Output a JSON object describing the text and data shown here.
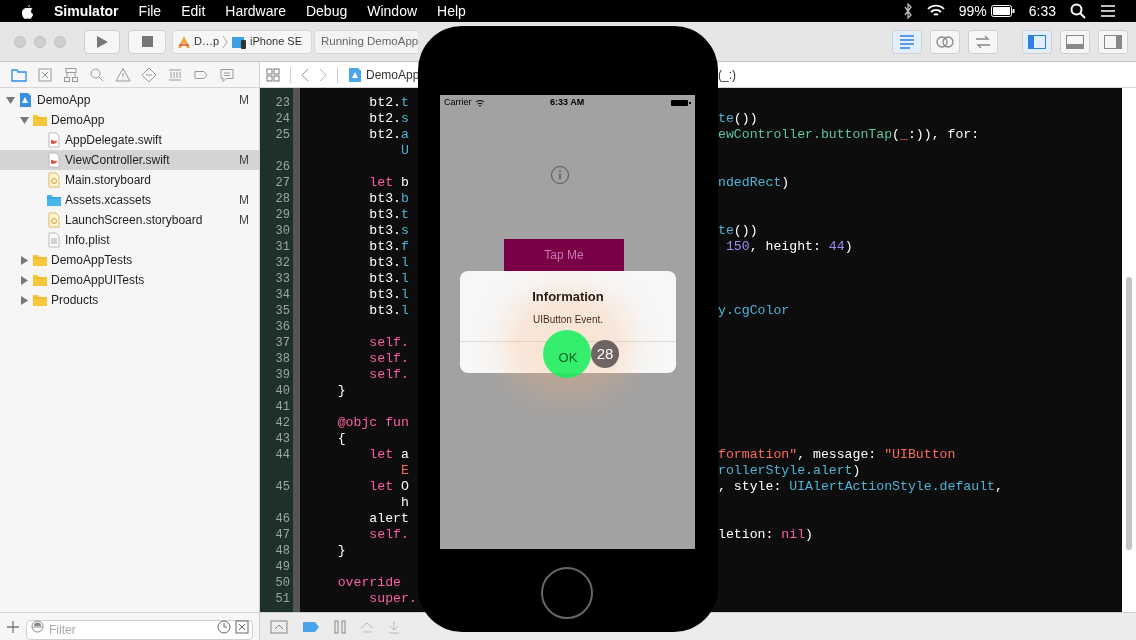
{
  "menu_bar": {
    "app": "Simulator",
    "items": [
      "File",
      "Edit",
      "Hardware",
      "Debug",
      "Window",
      "Help"
    ],
    "battery_text": "99%",
    "clock": "6:33"
  },
  "toolbar": {
    "scheme": "D…p",
    "destination": "iPhone SE",
    "status": "Running DemoApp",
    "editor_modes": [
      {
        "kind": "standard",
        "selected": true
      },
      {
        "kind": "assistant",
        "selected": false
      },
      {
        "kind": "version",
        "selected": false
      }
    ],
    "panels": [
      {
        "kind": "navigator",
        "selected": true
      },
      {
        "kind": "debug",
        "selected": false
      },
      {
        "kind": "utilities",
        "selected": false
      }
    ]
  },
  "navigator": {
    "tabs": [
      {
        "kind": "folder",
        "selected": true
      },
      {
        "kind": "source",
        "selected": false
      },
      {
        "kind": "hierarchy",
        "selected": false
      },
      {
        "kind": "search",
        "selected": false
      },
      {
        "kind": "warning",
        "selected": false
      },
      {
        "kind": "test",
        "selected": false
      },
      {
        "kind": "debug",
        "selected": false
      },
      {
        "kind": "breakpoint",
        "selected": false
      },
      {
        "kind": "report",
        "selected": false
      }
    ],
    "tree": [
      {
        "name": "DemoApp",
        "kind": "project",
        "status": "M",
        "selected": false,
        "expanded": true,
        "children": [
          {
            "name": "DemoApp",
            "kind": "folder",
            "selected": false,
            "expanded": true,
            "children": [
              {
                "name": "AppDelegate.swift",
                "kind": "swift",
                "selected": false
              },
              {
                "name": "ViewController.swift",
                "kind": "swift",
                "status": "M",
                "selected": true
              },
              {
                "name": "Main.storyboard",
                "kind": "storyboard",
                "selected": false
              },
              {
                "name": "Assets.xcassets",
                "kind": "assets",
                "status": "M",
                "selected": false
              },
              {
                "name": "LaunchScreen.storyboard",
                "kind": "storyboard",
                "status": "M",
                "selected": false
              },
              {
                "name": "Info.plist",
                "kind": "plist",
                "selected": false
              }
            ]
          },
          {
            "name": "DemoAppTests",
            "kind": "folder",
            "selected": false,
            "expanded": false
          },
          {
            "name": "DemoAppUITests",
            "kind": "folder",
            "selected": false,
            "expanded": false
          },
          {
            "name": "Products",
            "kind": "folder",
            "selected": false,
            "expanded": false
          }
        ]
      }
    ],
    "filter": {
      "placeholder": "Filter"
    }
  },
  "jump_bar": {
    "file": "DemoApp",
    "method": "(_:)"
  },
  "editor": {
    "lines": [
      {
        "number": "23",
        "left": [
          {
            "text": "        bt2.",
            "kind": "plain"
          },
          {
            "text": "t",
            "kind": "member"
          }
        ]
      },
      {
        "number": "24",
        "left": [
          {
            "text": "        bt2.",
            "kind": "plain"
          },
          {
            "text": "s",
            "kind": "member"
          }
        ],
        "right": [
          {
            "text": "te",
            "kind": "member"
          },
          {
            "text": "())",
            "kind": "plain"
          }
        ]
      },
      {
        "number": "25",
        "left": [
          {
            "text": "        bt2.",
            "kind": "plain"
          },
          {
            "text": "a",
            "kind": "member"
          }
        ],
        "right": [
          {
            "text": "ewController.buttonTap",
            "kind": "type"
          },
          {
            "text": "(",
            "kind": "plain"
          },
          {
            "text": "_",
            "kind": "string"
          },
          {
            "text": ":)), for:",
            "kind": "plain"
          }
        ]
      },
      {
        "left": [
          {
            "text": "            U",
            "kind": "member"
          }
        ]
      },
      {
        "number": "26"
      },
      {
        "number": "27",
        "left": [
          {
            "text": "        let",
            "kind": "keyword"
          },
          {
            "text": " b",
            "kind": "plain"
          }
        ],
        "right": [
          {
            "text": "ndedRect",
            "kind": "member"
          },
          {
            "text": ")",
            "kind": "plain"
          }
        ]
      },
      {
        "number": "28",
        "left": [
          {
            "text": "        bt3.",
            "kind": "plain"
          },
          {
            "text": "b",
            "kind": "member"
          }
        ]
      },
      {
        "number": "29",
        "left": [
          {
            "text": "        bt3.",
            "kind": "plain"
          },
          {
            "text": "t",
            "kind": "member"
          }
        ]
      },
      {
        "number": "30",
        "left": [
          {
            "text": "        bt3.",
            "kind": "plain"
          },
          {
            "text": "s",
            "kind": "member"
          }
        ],
        "right": [
          {
            "text": "te",
            "kind": "member"
          },
          {
            "text": "())",
            "kind": "plain"
          }
        ]
      },
      {
        "number": "31",
        "left": [
          {
            "text": "        bt3.",
            "kind": "plain"
          },
          {
            "text": "f",
            "kind": "member"
          }
        ],
        "right": [
          {
            "text": " 150",
            "kind": "number"
          },
          {
            "text": ", height: ",
            "kind": "plain"
          },
          {
            "text": "44",
            "kind": "number"
          },
          {
            "text": ")",
            "kind": "plain"
          }
        ]
      },
      {
        "number": "32",
        "left": [
          {
            "text": "        bt3.",
            "kind": "plain"
          },
          {
            "text": "l",
            "kind": "member"
          }
        ]
      },
      {
        "number": "33",
        "left": [
          {
            "text": "        bt3.",
            "kind": "plain"
          },
          {
            "text": "l",
            "kind": "member"
          }
        ]
      },
      {
        "number": "34",
        "left": [
          {
            "text": "        bt3.",
            "kind": "plain"
          },
          {
            "text": "l",
            "kind": "member"
          }
        ]
      },
      {
        "number": "35",
        "left": [
          {
            "text": "        bt3.",
            "kind": "plain"
          },
          {
            "text": "l",
            "kind": "member"
          }
        ],
        "right": [
          {
            "text": "y.cgColor",
            "kind": "member"
          }
        ]
      },
      {
        "number": "36"
      },
      {
        "number": "37",
        "left": [
          {
            "text": "        self.",
            "kind": "keyword"
          }
        ]
      },
      {
        "number": "38",
        "left": [
          {
            "text": "        self.",
            "kind": "keyword"
          }
        ]
      },
      {
        "number": "39",
        "left": [
          {
            "text": "        self.",
            "kind": "keyword"
          }
        ]
      },
      {
        "number": "40",
        "left": [
          {
            "text": "    }",
            "kind": "plain"
          }
        ]
      },
      {
        "number": "41"
      },
      {
        "number": "42",
        "left": [
          {
            "text": "    @objc fun",
            "kind": "keyword"
          }
        ]
      },
      {
        "number": "43",
        "left": [
          {
            "text": "    {",
            "kind": "plain"
          }
        ]
      },
      {
        "number": "44",
        "left": [
          {
            "text": "        let",
            "kind": "keyword"
          },
          {
            "text": " a",
            "kind": "plain"
          }
        ],
        "right": [
          {
            "text": "formation\"",
            "kind": "string"
          },
          {
            "text": ", message: ",
            "kind": "plain"
          },
          {
            "text": "\"UIButton",
            "kind": "string"
          }
        ]
      },
      {
        "left": [
          {
            "text": "            E",
            "kind": "string"
          }
        ],
        "right": [
          {
            "text": "rollerStyle.alert",
            "kind": "member"
          },
          {
            "text": ")",
            "kind": "plain"
          }
        ]
      },
      {
        "number": "45",
        "left": [
          {
            "text": "        let",
            "kind": "keyword"
          },
          {
            "text": " O",
            "kind": "plain"
          }
        ],
        "right": [
          {
            "text": ", style: ",
            "kind": "plain"
          },
          {
            "text": "UIAlertActionStyle.default",
            "kind": "member"
          },
          {
            "text": ",",
            "kind": "plain"
          }
        ]
      },
      {
        "left": [
          {
            "text": "            h",
            "kind": "plain"
          }
        ]
      },
      {
        "number": "46",
        "left": [
          {
            "text": "        alert",
            "kind": "plain"
          }
        ]
      },
      {
        "number": "47",
        "left": [
          {
            "text": "        self.",
            "kind": "keyword"
          }
        ],
        "right": [
          {
            "text": "letion: ",
            "kind": "plain"
          },
          {
            "text": "nil",
            "kind": "keyword"
          },
          {
            "text": ")",
            "kind": "plain"
          }
        ]
      },
      {
        "number": "48",
        "left": [
          {
            "text": "    }",
            "kind": "plain"
          }
        ]
      },
      {
        "number": "49"
      },
      {
        "number": "50",
        "left": [
          {
            "text": "    override",
            "kind": "keyword"
          }
        ]
      },
      {
        "number": "51",
        "left": [
          {
            "text": "        super.",
            "kind": "keyword"
          }
        ]
      }
    ]
  },
  "simulator": {
    "carrier": "Carrier",
    "time": "6:33 AM",
    "button": "Tap Me",
    "alert": {
      "title": "Information",
      "message": "UIButton Event.",
      "action": "OK"
    },
    "step_badge": "28"
  }
}
